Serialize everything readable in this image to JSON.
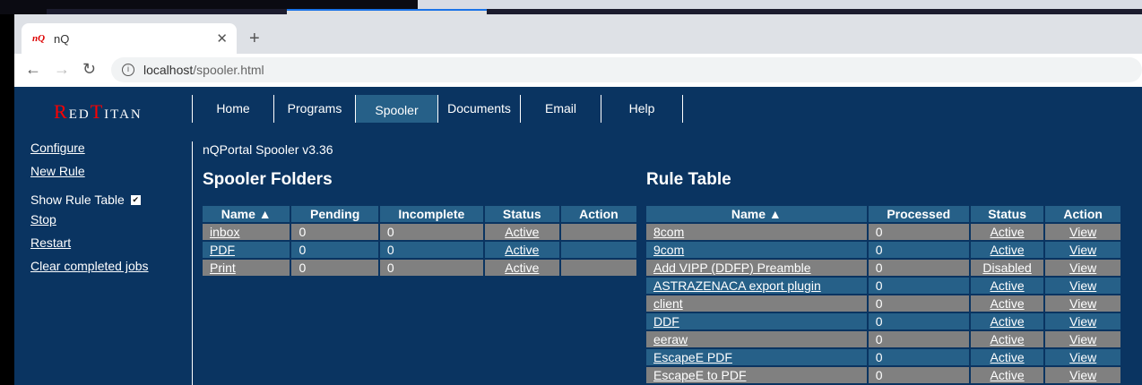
{
  "browser": {
    "tab_title": "nQ",
    "favicon": "nQ",
    "url_host": "localhost",
    "url_path": "/spooler.html"
  },
  "logo": {
    "r": "R",
    "ed": "ED",
    "t": "T",
    "itan": "ITAN"
  },
  "nav": [
    "Home",
    "Programs",
    "Spooler",
    "Documents",
    "Email",
    "Help"
  ],
  "sidebar": {
    "configure": "Configure",
    "new_rule": "New Rule",
    "show_rule_table": "Show Rule Table",
    "show_rule_table_checked": true,
    "stop": "Stop",
    "restart": "Restart",
    "clear": "Clear completed jobs"
  },
  "version": "nQPortal Spooler v3.36",
  "folders": {
    "title": "Spooler Folders",
    "headers": [
      "Name ▲",
      "Pending",
      "Incomplete",
      "Status",
      "Action"
    ],
    "rows": [
      {
        "name": "inbox",
        "pending": "0",
        "incomplete": "0",
        "status": "Active",
        "action": ""
      },
      {
        "name": "PDF",
        "pending": "0",
        "incomplete": "0",
        "status": "Active",
        "action": ""
      },
      {
        "name": "Print",
        "pending": "0",
        "incomplete": "0",
        "status": "Active",
        "action": ""
      }
    ]
  },
  "rules": {
    "title": "Rule Table",
    "headers": [
      "Name ▲",
      "Processed",
      "Status",
      "Action"
    ],
    "rows": [
      {
        "name": "8com",
        "processed": "0",
        "status": "Active",
        "action": "View"
      },
      {
        "name": "9com",
        "processed": "0",
        "status": "Active",
        "action": "View"
      },
      {
        "name": "Add VIPP (DDFP) Preamble",
        "processed": "0",
        "status": "Disabled",
        "action": "View"
      },
      {
        "name": "ASTRAZENACA export plugin",
        "processed": "0",
        "status": "Active",
        "action": "View"
      },
      {
        "name": "client",
        "processed": "0",
        "status": "Active",
        "action": "View"
      },
      {
        "name": "DDF",
        "processed": "0",
        "status": "Active",
        "action": "View"
      },
      {
        "name": "eeraw",
        "processed": "0",
        "status": "Active",
        "action": "View"
      },
      {
        "name": "EscapeE PDF",
        "processed": "0",
        "status": "Active",
        "action": "View"
      },
      {
        "name": "EscapeE to PDF",
        "processed": "0",
        "status": "Active",
        "action": "View"
      }
    ]
  }
}
